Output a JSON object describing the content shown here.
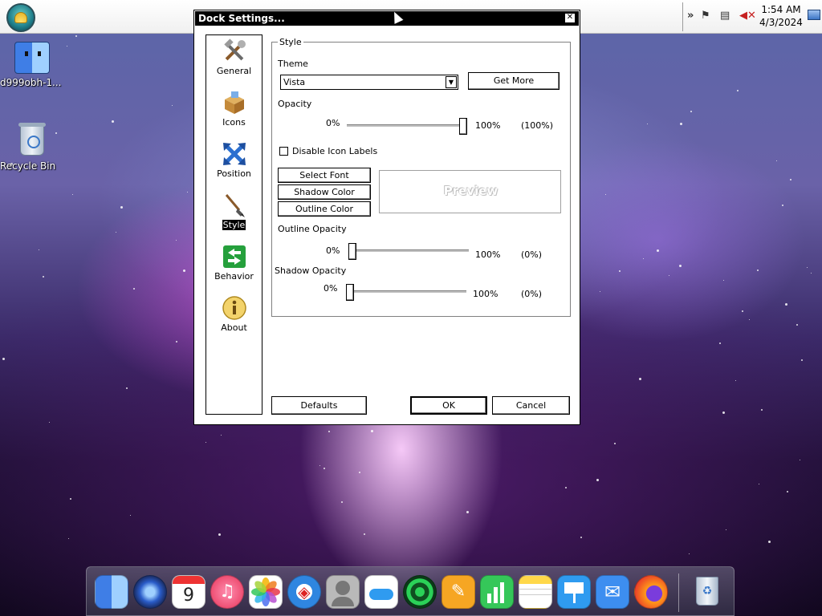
{
  "desktop": {
    "icons": [
      {
        "label": "d999obh-1..."
      },
      {
        "label": "Recycle Bin"
      }
    ]
  },
  "taskbar": {
    "tray": {
      "time": "1:54 AM",
      "date": "4/3/2024",
      "icons": [
        "chevron-icon",
        "flag-icon",
        "network-icon",
        "volume-muted-icon",
        "show-desktop-icon"
      ]
    }
  },
  "window": {
    "title": "Dock Settings...",
    "close_glyph": "✕",
    "nav": [
      {
        "label": "General",
        "icon": "tools-icon"
      },
      {
        "label": "Icons",
        "icon": "box-icon"
      },
      {
        "label": "Position",
        "icon": "arrows-icon"
      },
      {
        "label": "Style",
        "icon": "brush-icon",
        "active": true
      },
      {
        "label": "Behavior",
        "icon": "switch-icon"
      },
      {
        "label": "About",
        "icon": "info-icon"
      }
    ],
    "style": {
      "group_label": "Style",
      "theme_label": "Theme",
      "theme_value": "Vista",
      "get_more": "Get More",
      "opacity_label": "Opacity",
      "opacity_min": "0%",
      "opacity_max": "100%",
      "opacity_value": "(100%)",
      "opacity_level": 1.0,
      "disable_labels": "Disable Icon Labels",
      "disable_labels_checked": false,
      "select_font": "Select Font",
      "shadow_color": "Shadow Color",
      "outline_color": "Outline Color",
      "preview": "Preview",
      "outline_opacity_label": "Outline Opacity",
      "outline_min": "0%",
      "outline_max": "100%",
      "outline_value": "(0%)",
      "outline_level": 0.0,
      "shadow_opacity_label": "Shadow Opacity",
      "shadow_min": "0%",
      "shadow_max": "100%",
      "shadow_value": "(0%)",
      "shadow_level": 0.0
    },
    "buttons": {
      "defaults": "Defaults",
      "ok": "OK",
      "cancel": "Cancel"
    }
  },
  "dock": {
    "apps": [
      {
        "name": "finder-icon",
        "color": "#4a86e8"
      },
      {
        "name": "launchpad-icon",
        "color": "#2a5cc8"
      },
      {
        "name": "calendar-icon",
        "color": "#ffffff",
        "text": "9"
      },
      {
        "name": "music-icon",
        "color": "#f04a6a"
      },
      {
        "name": "photos-icon",
        "color": "#ffffff"
      },
      {
        "name": "safari-icon",
        "color": "#2f86e0"
      },
      {
        "name": "contacts-icon",
        "color": "#b9b9b9"
      },
      {
        "name": "icloud-icon",
        "color": "#ffffff"
      },
      {
        "name": "radar-icon",
        "color": "#1f8f3a"
      },
      {
        "name": "pages-icon",
        "color": "#f6a623"
      },
      {
        "name": "numbers-icon",
        "color": "#35c759"
      },
      {
        "name": "notes-icon",
        "color": "#ffd84a"
      },
      {
        "name": "keynote-icon",
        "color": "#2f9bf0"
      },
      {
        "name": "mail-icon",
        "color": "#3d8ef0"
      },
      {
        "name": "firefox-icon",
        "color": "#ff7a1a"
      },
      {
        "name": "trash-icon",
        "color": "#e0e6ee"
      }
    ]
  }
}
